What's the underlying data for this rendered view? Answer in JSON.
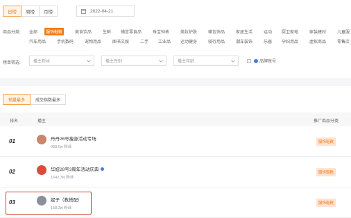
{
  "period_tabs": [
    "日榜",
    "周榜",
    "月榜"
  ],
  "date_value": "2022-04-21",
  "category_label": "商品分类:",
  "categories_row1": [
    "全部",
    "服饰鞋靴",
    "美食饮品",
    "生鲜",
    "铺音零食品",
    "珠宝钟表",
    "美妆护肤",
    "箱包饰品",
    "家居生活",
    "运动",
    "厨卫家电",
    "家装建材",
    "儿童服"
  ],
  "categories_row2": [
    "汽车用品",
    "手机数码",
    "宠物用品",
    "图书文娱",
    "二手",
    "工业品",
    "运动健身",
    "骑行用品",
    "潮车装饰",
    "乐器",
    "孕妇用品",
    "虚拟商品",
    "零售店"
  ],
  "filter_label": "榜单筛选:",
  "filters": [
    "播主粉丝",
    "播主性别",
    "播主年龄"
  ],
  "brand_checkbox_label": "品牌账号",
  "sort_tabs": [
    "销量最多",
    "成交指数最多"
  ],
  "table_headers": {
    "rank": "排名",
    "streamer": "播主",
    "category": "推广商品分类"
  },
  "rows": [
    {
      "rank": "01",
      "name": "丹丹26号瘦身活动专场",
      "fans": "988.0w 粉丝",
      "tag": "服饰鞋靴",
      "avatar_color": "#c9876a"
    },
    {
      "rank": "02",
      "name": "华妞28号3周年活动庆典",
      "fans": "1642.3w 粉丝",
      "tag": "服饰鞋靴",
      "avatar_color": "#d94b3a"
    },
    {
      "rank": "03",
      "name": "妮子（教搭配）",
      "fans": "158.3w 粉丝",
      "tag": "服饰鞋靴",
      "avatar_color": "#8b8f98"
    }
  ]
}
